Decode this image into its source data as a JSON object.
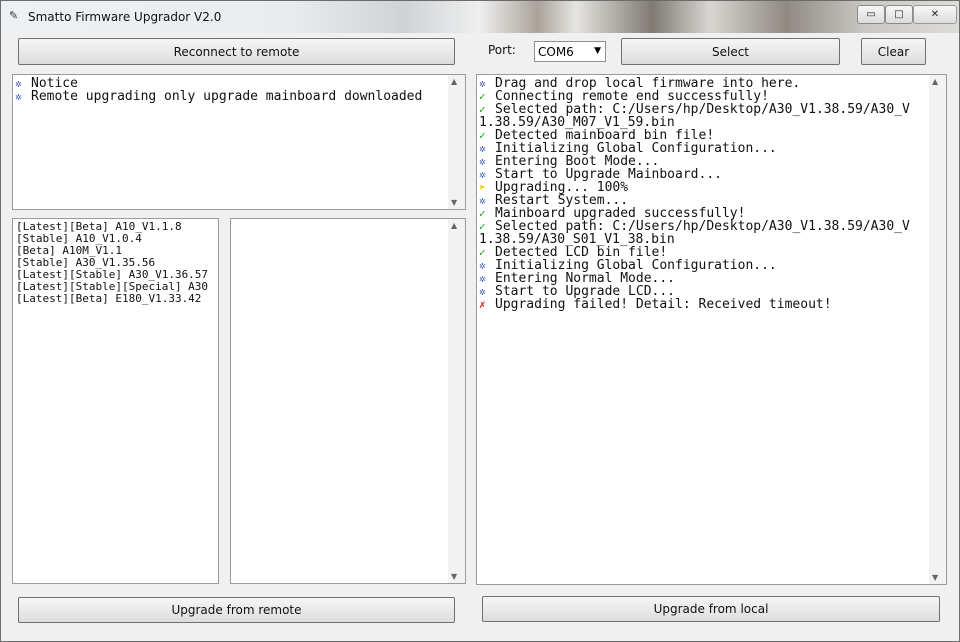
{
  "window": {
    "title": "Smatto Firmware Upgrador V2.0",
    "minimize_glyph": "▭",
    "maximize_glyph": "□",
    "close_glyph": "✕",
    "app_glyph": "✎"
  },
  "toolbar": {
    "reconnect_label": "Reconnect to remote",
    "port_label": "Port:",
    "port_value": "COM6",
    "dropdown_glyph": "▼",
    "select_label": "Select",
    "clear_label": "Clear"
  },
  "notice_log": [
    {
      "icon": "info",
      "text": "Notice"
    },
    {
      "icon": "info",
      "text": "Remote upgrading only upgrade mainboard downloaded"
    }
  ],
  "firmware_list": [
    "[Latest][Beta] A10_V1.1.8",
    "[Stable] A10_V1.0.4",
    "[Beta] A10M_V1.1",
    "[Stable] A30_V1.35.56",
    "[Latest][Stable] A30_V1.36.57",
    "[Latest][Stable][Special] A30",
    "[Latest][Beta] E180_V1.33.42"
  ],
  "main_log": [
    {
      "icon": "info",
      "text": "Drag and drop local firmware into here."
    },
    {
      "icon": "ok",
      "text": "Connecting remote end successfully!"
    },
    {
      "icon": "ok",
      "text": "Selected path: C:/Users/hp/Desktop/A30_V1.38.59/A30_V"
    },
    {
      "icon": "none",
      "text": "1.38.59/A30_M07_V1_59.bin"
    },
    {
      "icon": "ok",
      "text": "Detected mainboard bin file!"
    },
    {
      "icon": "info",
      "text": "Initializing Global Configuration..."
    },
    {
      "icon": "info",
      "text": "Entering Boot Mode..."
    },
    {
      "icon": "info",
      "text": "Start to Upgrade Mainboard..."
    },
    {
      "icon": "warn",
      "text": "Upgrading... 100%"
    },
    {
      "icon": "info",
      "text": "Restart System..."
    },
    {
      "icon": "ok",
      "text": "Mainboard upgraded successfully!"
    },
    {
      "icon": "ok",
      "text": "Selected path: C:/Users/hp/Desktop/A30_V1.38.59/A30_V"
    },
    {
      "icon": "none",
      "text": "1.38.59/A30_S01_V1_38.bin"
    },
    {
      "icon": "ok",
      "text": "Detected LCD bin file!"
    },
    {
      "icon": "info",
      "text": "Initializing Global Configuration..."
    },
    {
      "icon": "info",
      "text": "Entering Normal Mode..."
    },
    {
      "icon": "info",
      "text": "Start to Upgrade LCD..."
    },
    {
      "icon": "err",
      "text": "Upgrading failed! Detail: Received timeout!"
    }
  ],
  "icon_glyphs": {
    "info": "✲",
    "ok": "✓",
    "warn": "➤",
    "err": "✗",
    "none": ""
  },
  "bottom": {
    "upgrade_remote_label": "Upgrade from remote",
    "upgrade_local_label": "Upgrade from local"
  },
  "scroll_glyphs": {
    "up": "▲",
    "down": "▼"
  }
}
